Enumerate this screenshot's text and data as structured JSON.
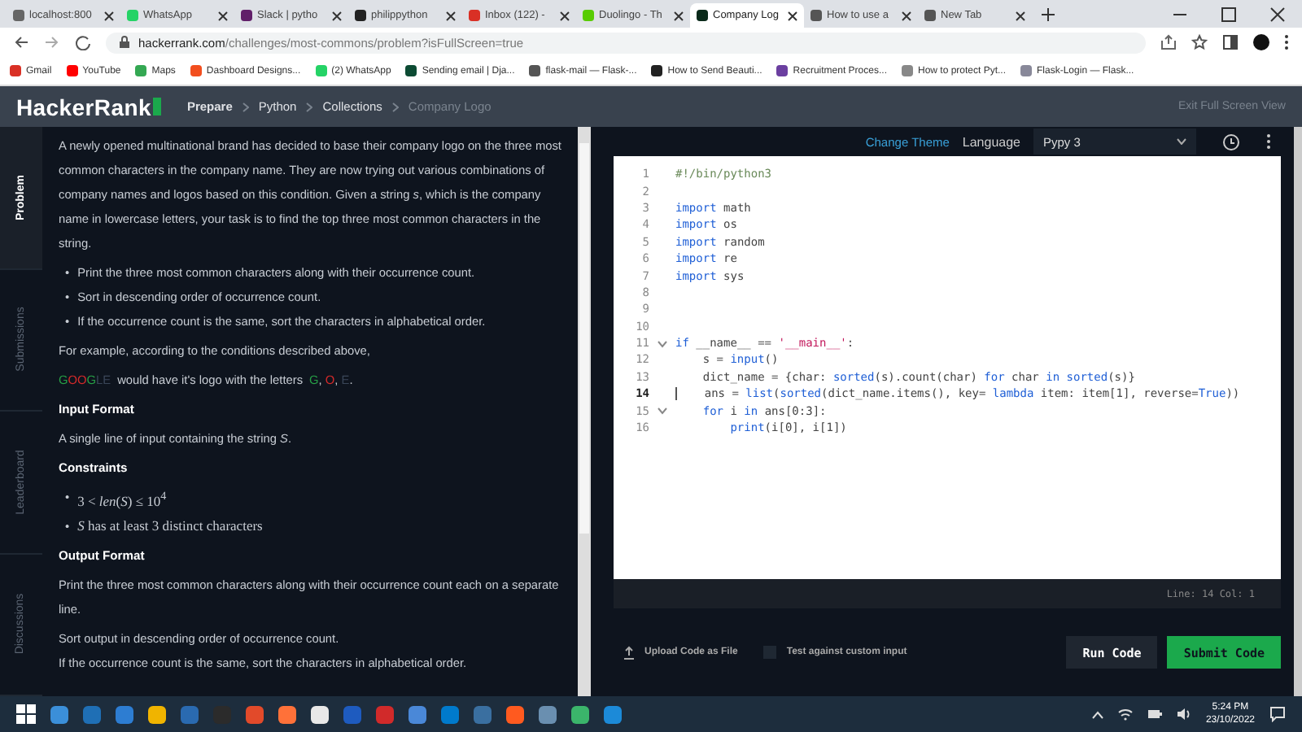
{
  "browser": {
    "tabs": [
      {
        "title": "localhost:800",
        "selected": false
      },
      {
        "title": "WhatsApp",
        "selected": false
      },
      {
        "title": "Slack | pytho",
        "selected": false
      },
      {
        "title": "philippython",
        "selected": false
      },
      {
        "title": "Inbox (122) -",
        "selected": false
      },
      {
        "title": "Duolingo - Th",
        "selected": false
      },
      {
        "title": "Company Log",
        "selected": true
      },
      {
        "title": "How to use a",
        "selected": false
      },
      {
        "title": "New Tab",
        "selected": false
      }
    ],
    "url": {
      "host": "hackerrank.com",
      "path": "/challenges/most-commons/problem?isFullScreen=true"
    },
    "bookmarks": [
      "Gmail",
      "YouTube",
      "Maps",
      "Dashboard Designs...",
      "(2) WhatsApp",
      "Sending email | Dja...",
      "flask-mail — Flask-...",
      "How to Send Beauti...",
      "Recruitment Proces...",
      "How to protect Pyt...",
      "Flask-Login — Flask..."
    ]
  },
  "header": {
    "logo": "HackerRank",
    "breadcrumbs": [
      {
        "label": "Prepare",
        "selected": false
      },
      {
        "label": "Python",
        "selected": false
      },
      {
        "label": "Collections",
        "selected": false
      },
      {
        "label": "Company Logo",
        "selected": true
      }
    ],
    "exit": "Exit Full Screen View"
  },
  "side_tabs": [
    {
      "label": "Problem",
      "selected": true
    },
    {
      "label": "Submissions",
      "selected": false
    },
    {
      "label": "Leaderboard",
      "selected": false
    },
    {
      "label": "Discussions",
      "selected": false
    }
  ],
  "problem": {
    "blocks": [
      {
        "kind": "para",
        "text": "A newly opened multinational brand has decided to base their company logo on the three most common characters in the company name. They are now trying out various combinations of company names and logos based on this condition. Given a string *s*, which is the company name in lowercase letters, your task is to find the top three most common characters in the string."
      },
      {
        "kind": "bullets",
        "marker": "•",
        "items": [
          "Print the three most common characters along with their occurrence count.",
          "Sort in descending order of occurrence count.",
          "If the occurrence count is the same, sort the characters in alphabetical order."
        ]
      },
      {
        "kind": "para",
        "text": "For example, according to the conditions described above,"
      },
      {
        "kind": "example",
        "word": [
          {
            "text": "G",
            "color": "#27a046"
          },
          {
            "text": "O",
            "color": "#d42a2a"
          },
          {
            "text": "O",
            "color": "#d42a2a"
          },
          {
            "text": "G",
            "color": "#27a046"
          },
          {
            "text": "L",
            "color": "#3a4658"
          },
          {
            "text": "E",
            "color": "#3a4658"
          }
        ],
        "text": "would have it's logo with the letters",
        "letters": [
          {
            "text": "G",
            "color": "#27a046"
          },
          {
            "text": "O",
            "color": "#d42a2a"
          },
          {
            "text": "E",
            "color": "#3a4658"
          }
        ],
        "separator": ", ",
        "end": "."
      },
      {
        "kind": "heading",
        "text": "Input Format"
      },
      {
        "kind": "para",
        "text": "A single line of input containing the string *S*."
      },
      {
        "kind": "heading",
        "text": "Constraints"
      },
      {
        "kind": "bullets",
        "marker": "•",
        "math": true,
        "items": [
          "3 < *len*(*S*) ≤ 10$^{4}$",
          "*S* has at least 3 distinct characters"
        ]
      },
      {
        "kind": "heading",
        "text": "Output Format"
      },
      {
        "kind": "para",
        "text": "Print the three most common characters along with their occurrence count each on a separate line."
      },
      {
        "kind": "line",
        "text": "Sort output in descending order of occurrence count."
      },
      {
        "kind": "line",
        "text": "If the occurrence count is the same, sort the characters in alphabetical order."
      }
    ]
  },
  "editor": {
    "change_theme": "Change Theme",
    "language_label": "Language",
    "language": "Pypy 3",
    "lines": [
      {
        "number": "1",
        "current": false,
        "fold": false,
        "tokens": [
          {
            "t": "#!/bin/python3",
            "kind": "comment"
          }
        ]
      },
      {
        "number": "2",
        "current": false,
        "fold": false
      },
      {
        "number": "3",
        "current": false,
        "fold": false,
        "tokens": [
          {
            "t": "import",
            "kind": "kw"
          },
          {
            "t": " math",
            "kind": "plain"
          }
        ]
      },
      {
        "number": "4",
        "current": false,
        "fold": false,
        "tokens": [
          {
            "t": "import",
            "kind": "kw"
          },
          {
            "t": " os",
            "kind": "plain"
          }
        ]
      },
      {
        "number": "5",
        "current": false,
        "fold": false,
        "tokens": [
          {
            "t": "import",
            "kind": "kw"
          },
          {
            "t": " random",
            "kind": "plain"
          }
        ]
      },
      {
        "number": "6",
        "current": false,
        "fold": false,
        "tokens": [
          {
            "t": "import",
            "kind": "kw"
          },
          {
            "t": " re",
            "kind": "plain"
          }
        ]
      },
      {
        "number": "7",
        "current": false,
        "fold": false,
        "tokens": [
          {
            "t": "import",
            "kind": "kw"
          },
          {
            "t": " sys",
            "kind": "plain"
          }
        ]
      },
      {
        "number": "8",
        "current": false,
        "fold": false
      },
      {
        "number": "9",
        "current": false,
        "fold": false
      },
      {
        "number": "10",
        "current": false,
        "fold": false
      },
      {
        "number": "11",
        "current": false,
        "fold": true,
        "tokens": [
          {
            "t": "if",
            "kind": "kw"
          },
          {
            "t": " __name__ == ",
            "kind": "plain"
          },
          {
            "t": "'__main__'",
            "kind": "str"
          },
          {
            "t": ":",
            "kind": "plain"
          }
        ]
      },
      {
        "number": "12",
        "current": false,
        "fold": false,
        "tokens": [
          {
            "t": "    s = ",
            "kind": "plain"
          },
          {
            "t": "input",
            "kind": "kw"
          },
          {
            "t": "()",
            "kind": "plain"
          }
        ]
      },
      {
        "number": "13",
        "current": false,
        "fold": false,
        "tokens": [
          {
            "t": "    dict_name = {char: ",
            "kind": "plain"
          },
          {
            "t": "sorted",
            "kind": "kw"
          },
          {
            "t": "(s).count(char) ",
            "kind": "plain"
          },
          {
            "t": "for",
            "kind": "kw"
          },
          {
            "t": " char ",
            "kind": "plain"
          },
          {
            "t": "in",
            "kind": "kw"
          },
          {
            "t": " sorted",
            "kind": "kw"
          },
          {
            "t": "(s)}",
            "kind": "plain"
          }
        ]
      },
      {
        "number": "14",
        "current": true,
        "fold": false,
        "tokens": [
          {
            "t": "    ans = ",
            "kind": "plain"
          },
          {
            "t": "list",
            "kind": "kw"
          },
          {
            "t": "(",
            "kind": "plain"
          },
          {
            "t": "sorted",
            "kind": "kw"
          },
          {
            "t": "(dict_name.items(), key= ",
            "kind": "plain"
          },
          {
            "t": "lambda",
            "kind": "kw"
          },
          {
            "t": " item: item[1], reverse=",
            "kind": "plain"
          },
          {
            "t": "True",
            "kind": "kw"
          },
          {
            "t": "))",
            "kind": "plain"
          }
        ]
      },
      {
        "number": "15",
        "current": false,
        "fold": true,
        "tokens": [
          {
            "t": "    for",
            "kind": "kw"
          },
          {
            "t": " i ",
            "kind": "plain"
          },
          {
            "t": "in",
            "kind": "kw"
          },
          {
            "t": " ans[0:3]:",
            "kind": "plain"
          }
        ]
      },
      {
        "number": "16",
        "current": false,
        "fold": false,
        "tokens": [
          {
            "t": "        print",
            "kind": "kw"
          },
          {
            "t": "(i[0], i[1])",
            "kind": "plain"
          }
        ]
      }
    ],
    "status": "Line: 14 Col: 1",
    "upload": "Upload Code as File",
    "custom_input": {
      "label": "Test against custom input",
      "checked": false
    },
    "run": "Run Code",
    "submit": "Submit Code"
  },
  "taskbar": {
    "time": "5:24 PM",
    "date": "23/10/2022"
  }
}
